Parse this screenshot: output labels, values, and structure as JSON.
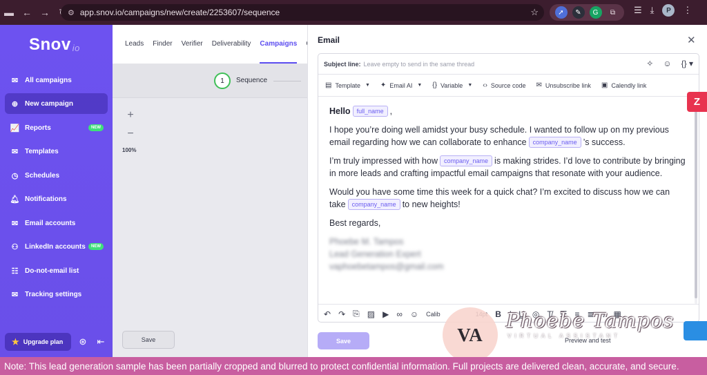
{
  "browser": {
    "url": "app.snov.io/campaigns/new/create/2253607/sequence",
    "profile_initial": "P"
  },
  "app": {
    "logo": "Snov",
    "logo_suffix": "io"
  },
  "sidebar": {
    "items": [
      {
        "label": "All campaigns",
        "icon": "envelope-icon"
      },
      {
        "label": "New campaign",
        "icon": "plus-circle-icon",
        "active": true
      },
      {
        "label": "Reports",
        "icon": "chart-icon",
        "badge": "NEW"
      },
      {
        "label": "Templates",
        "icon": "template-icon"
      },
      {
        "label": "Schedules",
        "icon": "clock-icon"
      },
      {
        "label": "Notifications",
        "icon": "bell-icon"
      },
      {
        "label": "Email accounts",
        "icon": "envelope-icon"
      },
      {
        "label": "LinkedIn accounts",
        "icon": "users-icon",
        "badge": "NEW"
      },
      {
        "label": "Do-not-email list",
        "icon": "list-icon"
      },
      {
        "label": "Tracking settings",
        "icon": "tracking-icon"
      }
    ],
    "upgrade_label": "Upgrade plan"
  },
  "topnav": {
    "tabs": [
      "Leads",
      "Finder",
      "Verifier",
      "Deliverability",
      "Campaigns",
      "C"
    ]
  },
  "canvas": {
    "step_number": "1",
    "step_label": "Sequence",
    "zoom_level": "100%",
    "save_label": "Save"
  },
  "email_panel": {
    "title": "Email",
    "subject_label": "Subject line:",
    "subject_placeholder": "Leave empty to send in the same thread",
    "toolbar": {
      "template": "Template",
      "email_ai": "Email AI",
      "variable": "Variable",
      "source_code": "Source code",
      "unsubscribe_link": "Unsubscribe link",
      "calendly_link": "Calendly link"
    },
    "body": {
      "greeting": "Hello",
      "greeting_var": "full_name",
      "greeting_end": ",",
      "p1_a": "I hope you’re doing well amidst your busy schedule. I wanted to follow up on my previous email regarding how we can collaborate to enhance",
      "p1_var": "company_name",
      "p1_b": "’s success.",
      "p2_a": "I’m truly impressed with how",
      "p2_var": "company_name",
      "p2_b": "is making strides. I’d love to contribute by bringing in more leads and crafting impactful email campaigns that resonate with your audience.",
      "p3_a": "Would you have some time this week for a quick chat? I’m excited to discuss how we can take",
      "p3_var": "company_name",
      "p3_b": "to new heights!",
      "closing": "Best regards,",
      "sig_name": "Phoebe M. Tampos",
      "sig_title": "Lead Generation Expert",
      "sig_email": "vaphoebetampos@gmail.com"
    },
    "format_bar": {
      "font": "Calib",
      "font_size": "14pt"
    },
    "save_label": "Save",
    "preview_label": "Preview and test"
  },
  "watermark": {
    "initials": "VA",
    "name": "Phoebe Tampos",
    "tagline": "VIRTUAL ASSISTANT"
  },
  "note": "Note: This lead generation sample  has been partially cropped and blurred to protect confidential information. Full projects are delivered clean, accurate, and secure.",
  "colors": {
    "brand": "#6d52f0",
    "accent": "#5b4cf0",
    "note_banner": "#c85ea0",
    "chrome": "#3c1d2e"
  }
}
